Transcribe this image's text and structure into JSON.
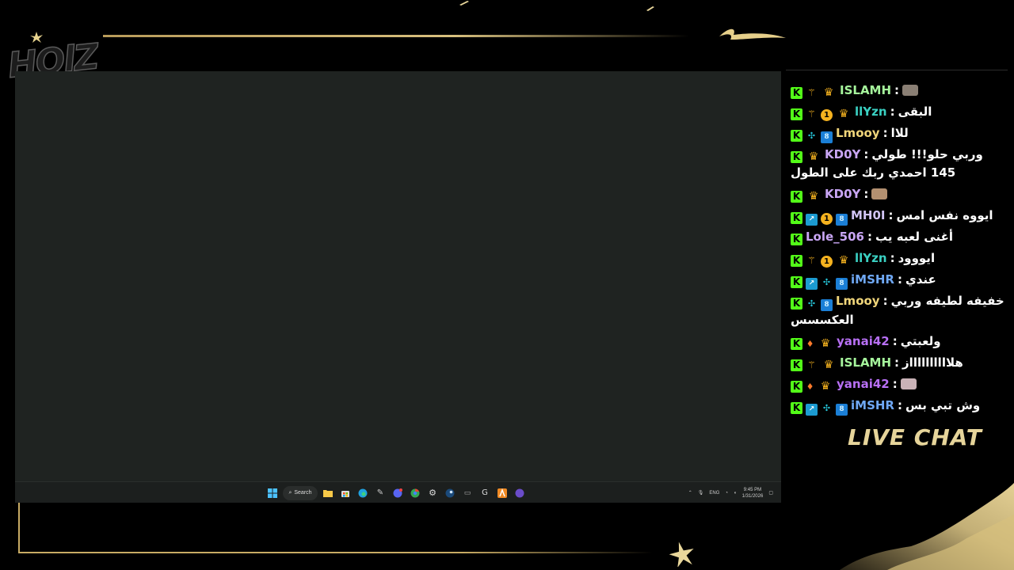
{
  "overlay": {
    "logo_text": "HOlZ",
    "live_chat_label": "LIVE CHAT",
    "accent_color": "#c8ab64"
  },
  "taskbar": {
    "search_label": "Search",
    "language": "ENG",
    "time": "9:45 PM",
    "date": "1/31/2026"
  },
  "chat": {
    "messages": [
      {
        "user": "ISLAMH",
        "user_color": "#a6f59c",
        "badges": [
          "kick",
          "vip",
          "crown"
        ],
        "text": "",
        "emote": "emote-face-1"
      },
      {
        "user": "llYzn",
        "user_color": "#3ad0c2",
        "badges": [
          "kick",
          "vip",
          "num-1",
          "crown"
        ],
        "text": "البقى"
      },
      {
        "user": "Lmooy",
        "user_color": "#f0d57a",
        "badges": [
          "kick",
          "gift",
          "og"
        ],
        "text": "للاا"
      },
      {
        "user": "KD0Y",
        "user_color": "#c9a6f5",
        "badges": [
          "kick",
          "crown"
        ],
        "text": "وربي حلو!!! طولي 145 احمدي ربك على الطول"
      },
      {
        "user": "KD0Y",
        "user_color": "#c9a6f5",
        "badges": [
          "kick",
          "crown"
        ],
        "text": "",
        "emote": "emote-face-2"
      },
      {
        "user": "MH0I",
        "user_color": "#d1c4f5",
        "badges": [
          "kick",
          "sub",
          "num-1",
          "og"
        ],
        "text": "ايووه نفس امس"
      },
      {
        "user": "Lole_506",
        "user_color": "#c9a6f5",
        "badges": [
          "kick"
        ],
        "text": "أغنى لعبه يب",
        "emote": "emote-small"
      },
      {
        "user": "llYzn",
        "user_color": "#3ad0c2",
        "badges": [
          "kick",
          "vip",
          "num-1",
          "crown"
        ],
        "text": "ايووود"
      },
      {
        "user": "iMSHR",
        "user_color": "#6fa8f5",
        "badges": [
          "kick",
          "sub",
          "gift",
          "og"
        ],
        "text": "عندي"
      },
      {
        "user": "Lmooy",
        "user_color": "#f0d57a",
        "badges": [
          "kick",
          "gift",
          "og"
        ],
        "text": "خفيفه لطيفه وربي العكسسس"
      },
      {
        "user": "yanai42",
        "user_color": "#b870f5",
        "badges": [
          "kick",
          "fire",
          "crown"
        ],
        "text": "ولعبتي"
      },
      {
        "user": "ISLAMH",
        "user_color": "#a6f59c",
        "badges": [
          "kick",
          "vip",
          "crown"
        ],
        "text": "هلااااااااااز"
      },
      {
        "user": "yanai42",
        "user_color": "#b870f5",
        "badges": [
          "kick",
          "fire",
          "crown"
        ],
        "text": "",
        "emote": "emote-face-3"
      },
      {
        "user": "iMSHR",
        "user_color": "#6fa8f5",
        "badges": [
          "kick",
          "sub",
          "gift",
          "og"
        ],
        "text": "وش تبي بس"
      }
    ],
    "separator": ":"
  }
}
